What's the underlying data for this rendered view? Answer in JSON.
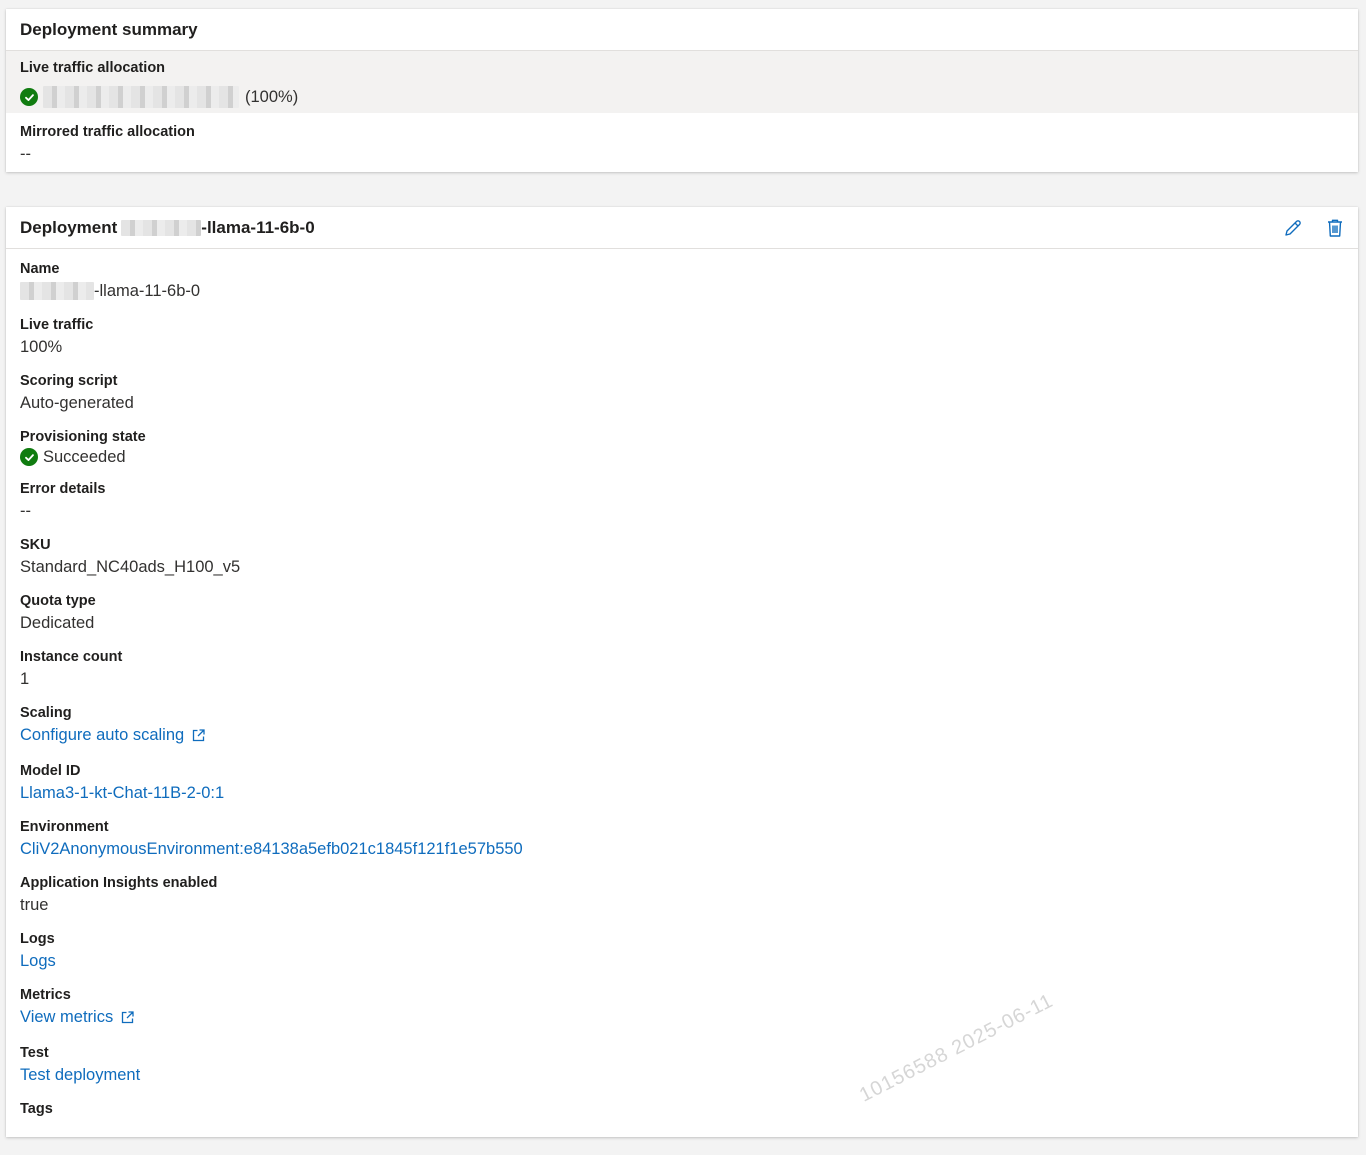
{
  "summary": {
    "title": "Deployment summary",
    "live_traffic_label": "Live traffic allocation",
    "live_traffic_percent": "(100%)",
    "mirrored_label": "Mirrored traffic allocation",
    "mirrored_value": "--"
  },
  "deployment": {
    "title_prefix": "Deployment",
    "title_suffix": "-llama-11-6b-0",
    "actions": {
      "edit_icon": "pencil-icon",
      "delete_icon": "trash-icon"
    },
    "fields": {
      "name": {
        "label": "Name",
        "value_suffix": "-llama-11-6b-0"
      },
      "live_traffic": {
        "label": "Live traffic",
        "value": "100%"
      },
      "scoring_script": {
        "label": "Scoring script",
        "value": "Auto-generated"
      },
      "provisioning_state": {
        "label": "Provisioning state",
        "value": "Succeeded"
      },
      "error_details": {
        "label": "Error details",
        "value": "--"
      },
      "sku": {
        "label": "SKU",
        "value": "Standard_NC40ads_H100_v5"
      },
      "quota_type": {
        "label": "Quota type",
        "value": "Dedicated"
      },
      "instance_count": {
        "label": "Instance count",
        "value": "1"
      },
      "scaling": {
        "label": "Scaling",
        "link": "Configure auto scaling"
      },
      "model_id": {
        "label": "Model ID",
        "link": "Llama3-1-kt-Chat-11B-2-0:1"
      },
      "environment": {
        "label": "Environment",
        "link": "CliV2AnonymousEnvironment:e84138a5efb021c1845f121f1e57b550"
      },
      "app_insights": {
        "label": "Application Insights enabled",
        "value": "true"
      },
      "logs": {
        "label": "Logs",
        "link": "Logs"
      },
      "metrics": {
        "label": "Metrics",
        "link": "View metrics"
      },
      "test": {
        "label": "Test",
        "link": "Test deployment"
      },
      "tags": {
        "label": "Tags"
      }
    }
  },
  "watermark": "10156588  2025-06-11",
  "colors": {
    "link": "#0f6cbd",
    "success": "#107c10",
    "row_highlight": "#f3f2f1",
    "page_bg": "#f3f3f3"
  }
}
